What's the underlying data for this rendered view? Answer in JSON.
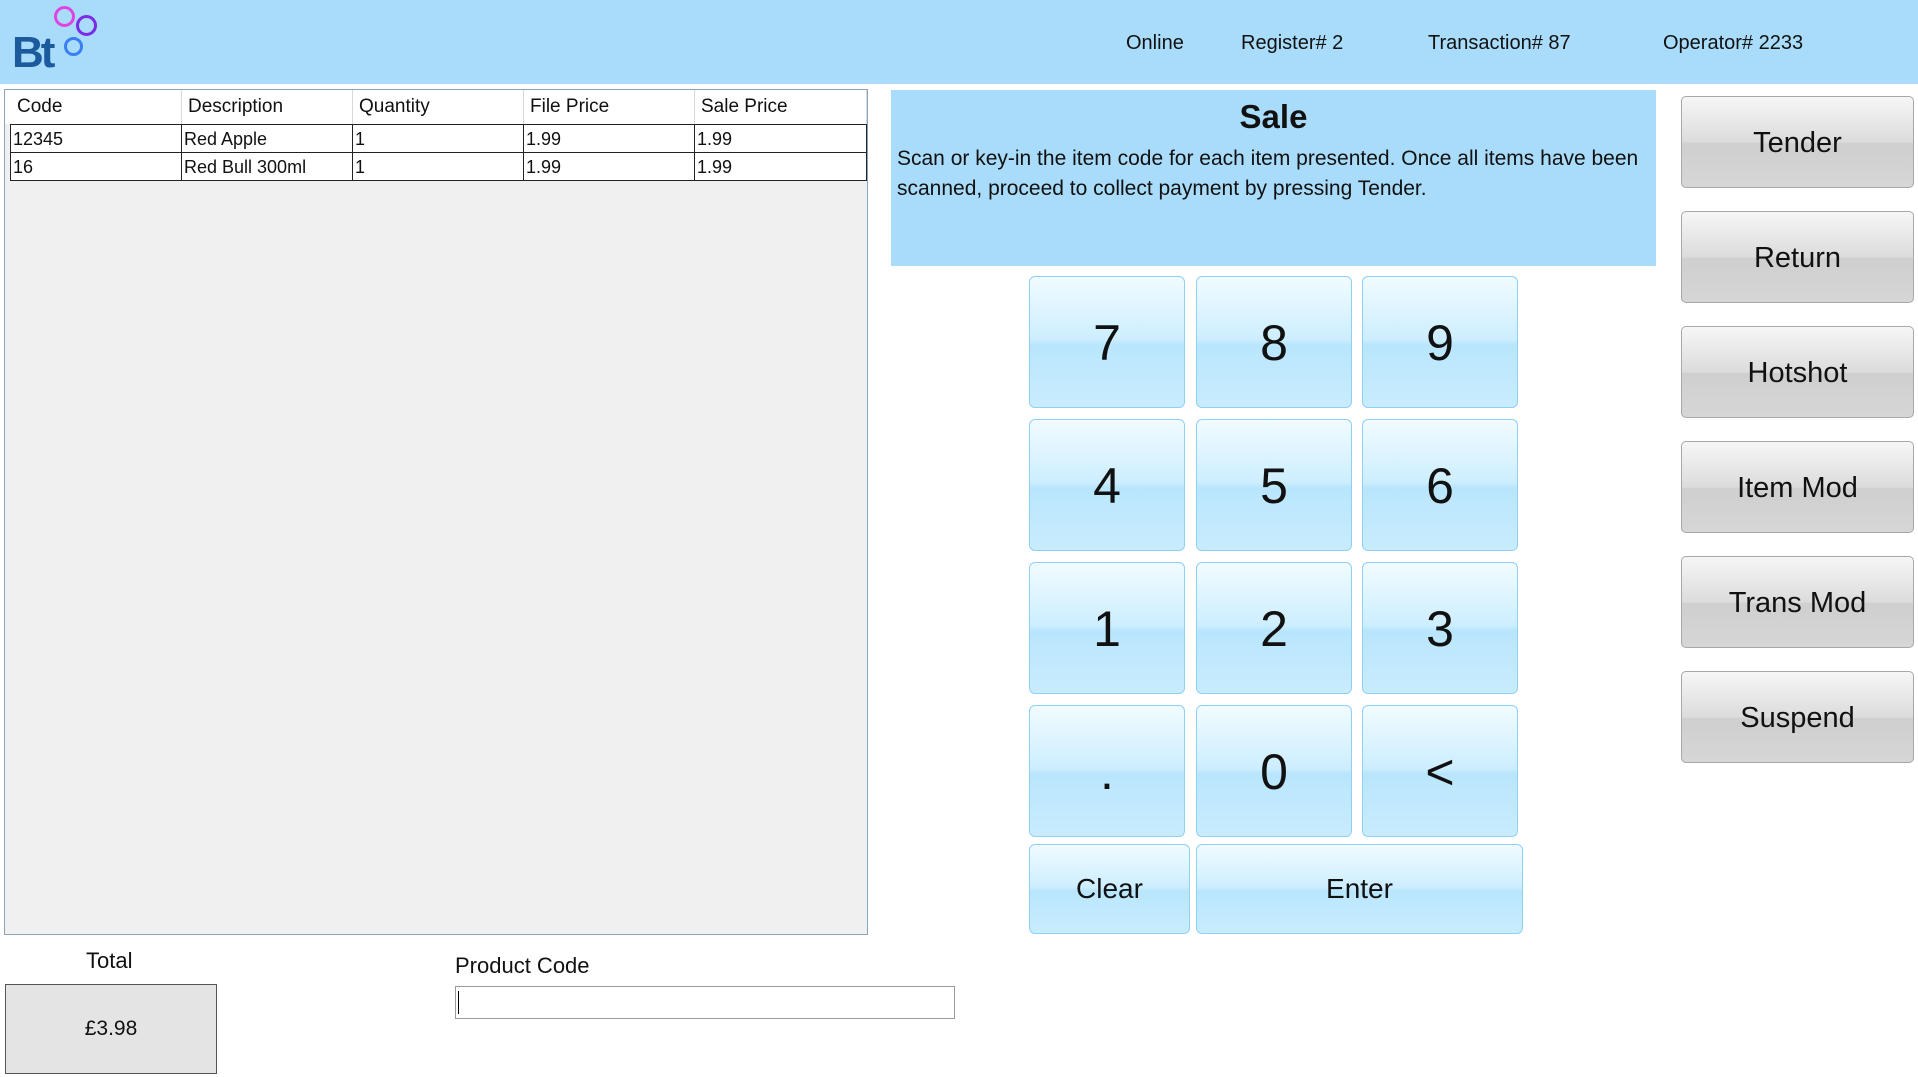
{
  "header": {
    "logo_text": "Bt",
    "status": "Online",
    "register": "Register# 2",
    "transaction": "Transaction# 87",
    "operator": "Operator# 2233"
  },
  "table": {
    "columns": [
      "Code",
      "Description",
      "Quantity",
      "File Price",
      "Sale Price"
    ],
    "rows": [
      [
        "12345",
        "Red Apple",
        "1",
        "1.99",
        "1.99"
      ],
      [
        "16",
        "Red Bull 300ml",
        "1",
        "1.99",
        "1.99"
      ]
    ]
  },
  "info": {
    "title": "Sale",
    "message": "Scan or key-in the item code for each item presented. Once all items have been scanned, proceed to collect payment by pressing Tender."
  },
  "keypad": {
    "rows": [
      [
        "7",
        "8",
        "9"
      ],
      [
        "4",
        "5",
        "6"
      ],
      [
        "1",
        "2",
        "3"
      ],
      [
        ".",
        "0",
        "<"
      ]
    ],
    "clear": "Clear",
    "enter": "Enter"
  },
  "actions": [
    "Tender",
    "Return",
    "Hotshot",
    "Item Mod",
    "Trans Mod",
    "Suspend"
  ],
  "footer": {
    "total_label": "Total",
    "total_value": "£3.98",
    "product_code_label": "Product Code",
    "product_code_value": ""
  }
}
